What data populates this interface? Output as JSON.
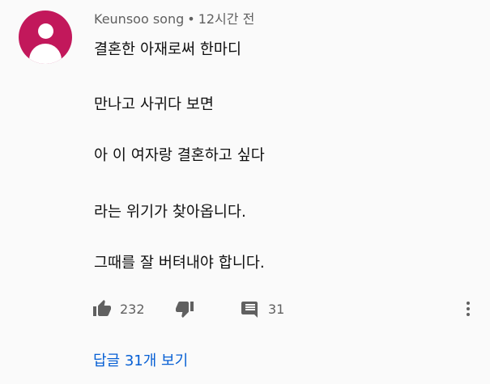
{
  "comment": {
    "author": "Keunsoo song",
    "separator": "•",
    "time": "12시간 전",
    "lines": [
      "결혼한 아재로써 한마디",
      "만나고 사귀다 보면",
      "아 이 여자랑 결혼하고 싶다",
      "라는 위기가 찾아옵니다.",
      "그때를 잘 버텨내야 합니다."
    ]
  },
  "actions": {
    "like_icon": "thumbs-up-icon",
    "like_count": "232",
    "dislike_icon": "thumbs-down-icon",
    "reply_icon": "comment-icon",
    "reply_count": "31",
    "more_icon": "more-vert-icon"
  },
  "replies": {
    "label": "답글 31개 보기"
  },
  "colors": {
    "avatar": "#c2185b",
    "link": "#065fd4",
    "secondary_text": "#606060",
    "icon": "#606060",
    "background": "#fafafa"
  }
}
